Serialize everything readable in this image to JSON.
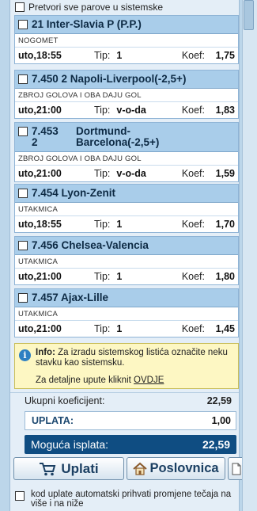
{
  "top_option": {
    "label": "Pretvori sve parove u sistemske"
  },
  "bets": [
    {
      "title": "21  Inter-Slavia P (P.P.)",
      "category": "NOGOMET",
      "time": "uto,18:55",
      "tip_label": "Tip:",
      "tip": "1",
      "koef_label": "Koef:",
      "koef": "1,75"
    },
    {
      "title": "7.450 2  Napoli-Liverpool(-2,5+)",
      "category": "ZBROJ GOLOVA I OBA DAJU GOL",
      "time": "uto,21:00",
      "tip_label": "Tip:",
      "tip": "v-o-da",
      "koef_label": "Koef:",
      "koef": "1,83"
    },
    {
      "title_line1": "7.453      Dortmund-",
      "title_line2": "2           Barcelona(-2,5+)",
      "category": "ZBROJ GOLOVA I OBA DAJU GOL",
      "time": "uto,21:00",
      "tip_label": "Tip:",
      "tip": "v-o-da",
      "koef_label": "Koef:",
      "koef": "1,59"
    },
    {
      "title": "7.454  Lyon-Zenit",
      "category": "UTAKMICA",
      "time": "uto,18:55",
      "tip_label": "Tip:",
      "tip": "1",
      "koef_label": "Koef:",
      "koef": "1,70"
    },
    {
      "title": "7.456  Chelsea-Valencia",
      "category": "UTAKMICA",
      "time": "uto,21:00",
      "tip_label": "Tip:",
      "tip": "1",
      "koef_label": "Koef:",
      "koef": "1,80"
    },
    {
      "title": "7.457  Ajax-Lille",
      "category": "UTAKMICA",
      "time": "uto,21:00",
      "tip_label": "Tip:",
      "tip": "1",
      "koef_label": "Koef:",
      "koef": "1,45"
    }
  ],
  "info": {
    "label": "Info:",
    "text": " Za izradu sistemskog listića označite neku stavku kao sistemsku.",
    "link_prefix": "Za detaljne upute kliknit ",
    "link": "OVDJE"
  },
  "summary": {
    "total_coef_label": "Ukupni koeficijent:",
    "total_coef": "22,59",
    "uplata_label": "UPLATA:",
    "uplata": "1,00",
    "isplata_label": "Moguća isplata:",
    "isplata": "22,59"
  },
  "buttons": {
    "uplati": "Uplati",
    "poslovnica": "Poslovnica"
  },
  "bottom_option": {
    "label": "kod uplate automatski prihvati promjene tečaja na više i na niže"
  },
  "icons": {
    "info": "info-icon",
    "cart": "cart-icon",
    "home": "home-icon",
    "document": "document-icon"
  }
}
